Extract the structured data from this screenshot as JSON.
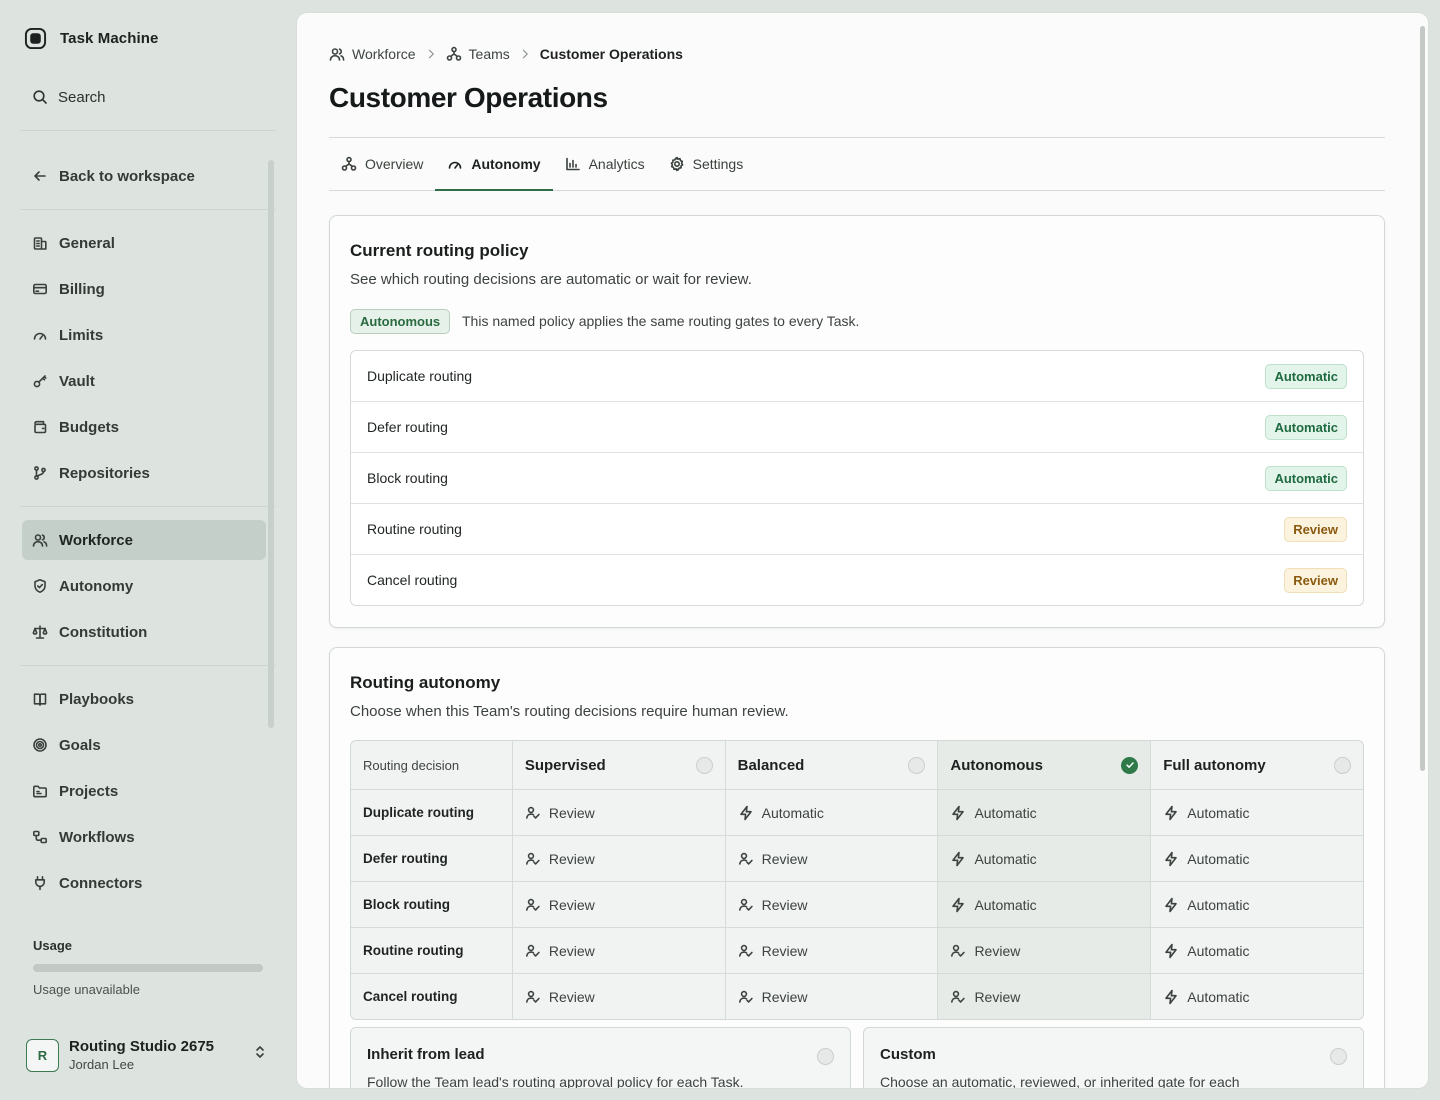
{
  "app": {
    "name": "Task Machine"
  },
  "sidebar": {
    "search_label": "Search",
    "back_label": "Back to workspace",
    "groups": [
      [
        {
          "label": "General",
          "icon": "building-icon"
        },
        {
          "label": "Billing",
          "icon": "credit-card-icon"
        },
        {
          "label": "Limits",
          "icon": "gauge-icon"
        },
        {
          "label": "Vault",
          "icon": "key-icon"
        },
        {
          "label": "Budgets",
          "icon": "wallet-icon"
        },
        {
          "label": "Repositories",
          "icon": "git-branch-icon"
        }
      ],
      [
        {
          "label": "Workforce",
          "icon": "users-icon",
          "active": true
        },
        {
          "label": "Autonomy",
          "icon": "shield-icon"
        },
        {
          "label": "Constitution",
          "icon": "scale-icon"
        }
      ],
      [
        {
          "label": "Playbooks",
          "icon": "book-icon"
        },
        {
          "label": "Goals",
          "icon": "target-icon"
        },
        {
          "label": "Projects",
          "icon": "folder-icon"
        },
        {
          "label": "Workflows",
          "icon": "workflow-icon"
        },
        {
          "label": "Connectors",
          "icon": "plug-icon"
        }
      ]
    ],
    "usage": {
      "title": "Usage",
      "status": "Usage unavailable"
    },
    "account": {
      "initial": "R",
      "name": "Routing Studio 2675",
      "user": "Jordan Lee"
    }
  },
  "breadcrumb": {
    "items": [
      "Workforce",
      "Teams"
    ],
    "current": "Customer Operations"
  },
  "page": {
    "title": "Customer Operations"
  },
  "tabs": [
    {
      "label": "Overview",
      "icon": "team-icon"
    },
    {
      "label": "Autonomy",
      "icon": "gauge-icon",
      "active": true
    },
    {
      "label": "Analytics",
      "icon": "bar-chart-icon"
    },
    {
      "label": "Settings",
      "icon": "gear-icon"
    }
  ],
  "current_policy": {
    "title": "Current routing policy",
    "subtitle": "See which routing decisions are automatic or wait for review.",
    "policy_name": "Autonomous",
    "policy_note": "This named policy applies the same routing gates to every Task.",
    "rows": [
      {
        "name": "Duplicate routing",
        "status": "Automatic"
      },
      {
        "name": "Defer routing",
        "status": "Automatic"
      },
      {
        "name": "Block routing",
        "status": "Automatic"
      },
      {
        "name": "Routine routing",
        "status": "Review"
      },
      {
        "name": "Cancel routing",
        "status": "Review"
      }
    ]
  },
  "routing_autonomy": {
    "title": "Routing autonomy",
    "subtitle": "Choose when this Team's routing decisions require human review.",
    "header_label": "Routing decision",
    "columns": [
      {
        "label": "Supervised",
        "selected": false
      },
      {
        "label": "Balanced",
        "selected": false
      },
      {
        "label": "Autonomous",
        "selected": true
      },
      {
        "label": "Full autonomy",
        "selected": false
      }
    ],
    "rows": [
      {
        "name": "Duplicate routing",
        "values": [
          "Review",
          "Automatic",
          "Automatic",
          "Automatic"
        ]
      },
      {
        "name": "Defer routing",
        "values": [
          "Review",
          "Review",
          "Automatic",
          "Automatic"
        ]
      },
      {
        "name": "Block routing",
        "values": [
          "Review",
          "Review",
          "Automatic",
          "Automatic"
        ]
      },
      {
        "name": "Routine routing",
        "values": [
          "Review",
          "Review",
          "Review",
          "Automatic"
        ]
      },
      {
        "name": "Cancel routing",
        "values": [
          "Review",
          "Review",
          "Review",
          "Automatic"
        ]
      }
    ],
    "options": [
      {
        "title": "Inherit from lead",
        "desc": "Follow the Team lead's routing approval policy for each Task."
      },
      {
        "title": "Custom",
        "desc": "Choose an automatic, reviewed, or inherited gate for each"
      }
    ]
  },
  "colors": {
    "accent": "#2f7a48",
    "automatic": "#1f6b3f",
    "review": "#8a5a10"
  }
}
